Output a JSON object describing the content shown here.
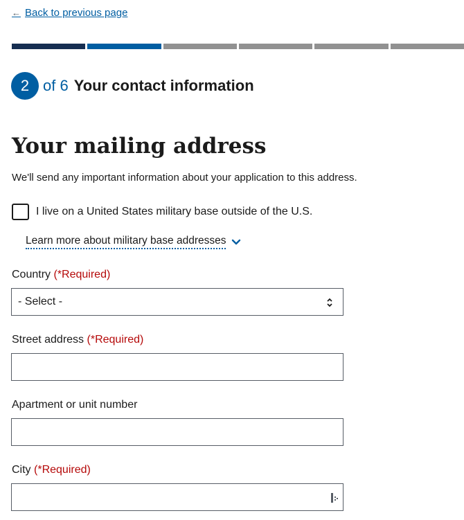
{
  "nav": {
    "back_arrow": "←",
    "back_label": "Back to previous page"
  },
  "progress": {
    "total_segments": 6,
    "current_step": 2,
    "colors": {
      "complete": "#162e51",
      "current": "#005ea2",
      "upcoming": "#919191"
    }
  },
  "step": {
    "number": "2",
    "of_text": "of 6",
    "title": "Your contact information"
  },
  "page": {
    "title": "Your mailing address",
    "intro": "We'll send any important information about your application to this address."
  },
  "military": {
    "checkbox_label": "I live on a United States military base outside of the U.S.",
    "checked": false,
    "learn_more": "Learn more about military base addresses",
    "learn_more_icon": "chevron-down-icon"
  },
  "fields": {
    "country": {
      "label": "Country",
      "required": "(*Required)",
      "value": "- Select -",
      "icon": "select-arrows-icon"
    },
    "street": {
      "label": "Street address",
      "required": "(*Required)",
      "value": ""
    },
    "apartment": {
      "label": "Apartment or unit number",
      "value": ""
    },
    "city": {
      "label": "City",
      "required": "(*Required)",
      "value": "",
      "icon": "autofill-icon"
    }
  },
  "colors": {
    "link": "#005ea2",
    "required": "#b50909",
    "text": "#1b1b1b",
    "border": "#565c65"
  }
}
